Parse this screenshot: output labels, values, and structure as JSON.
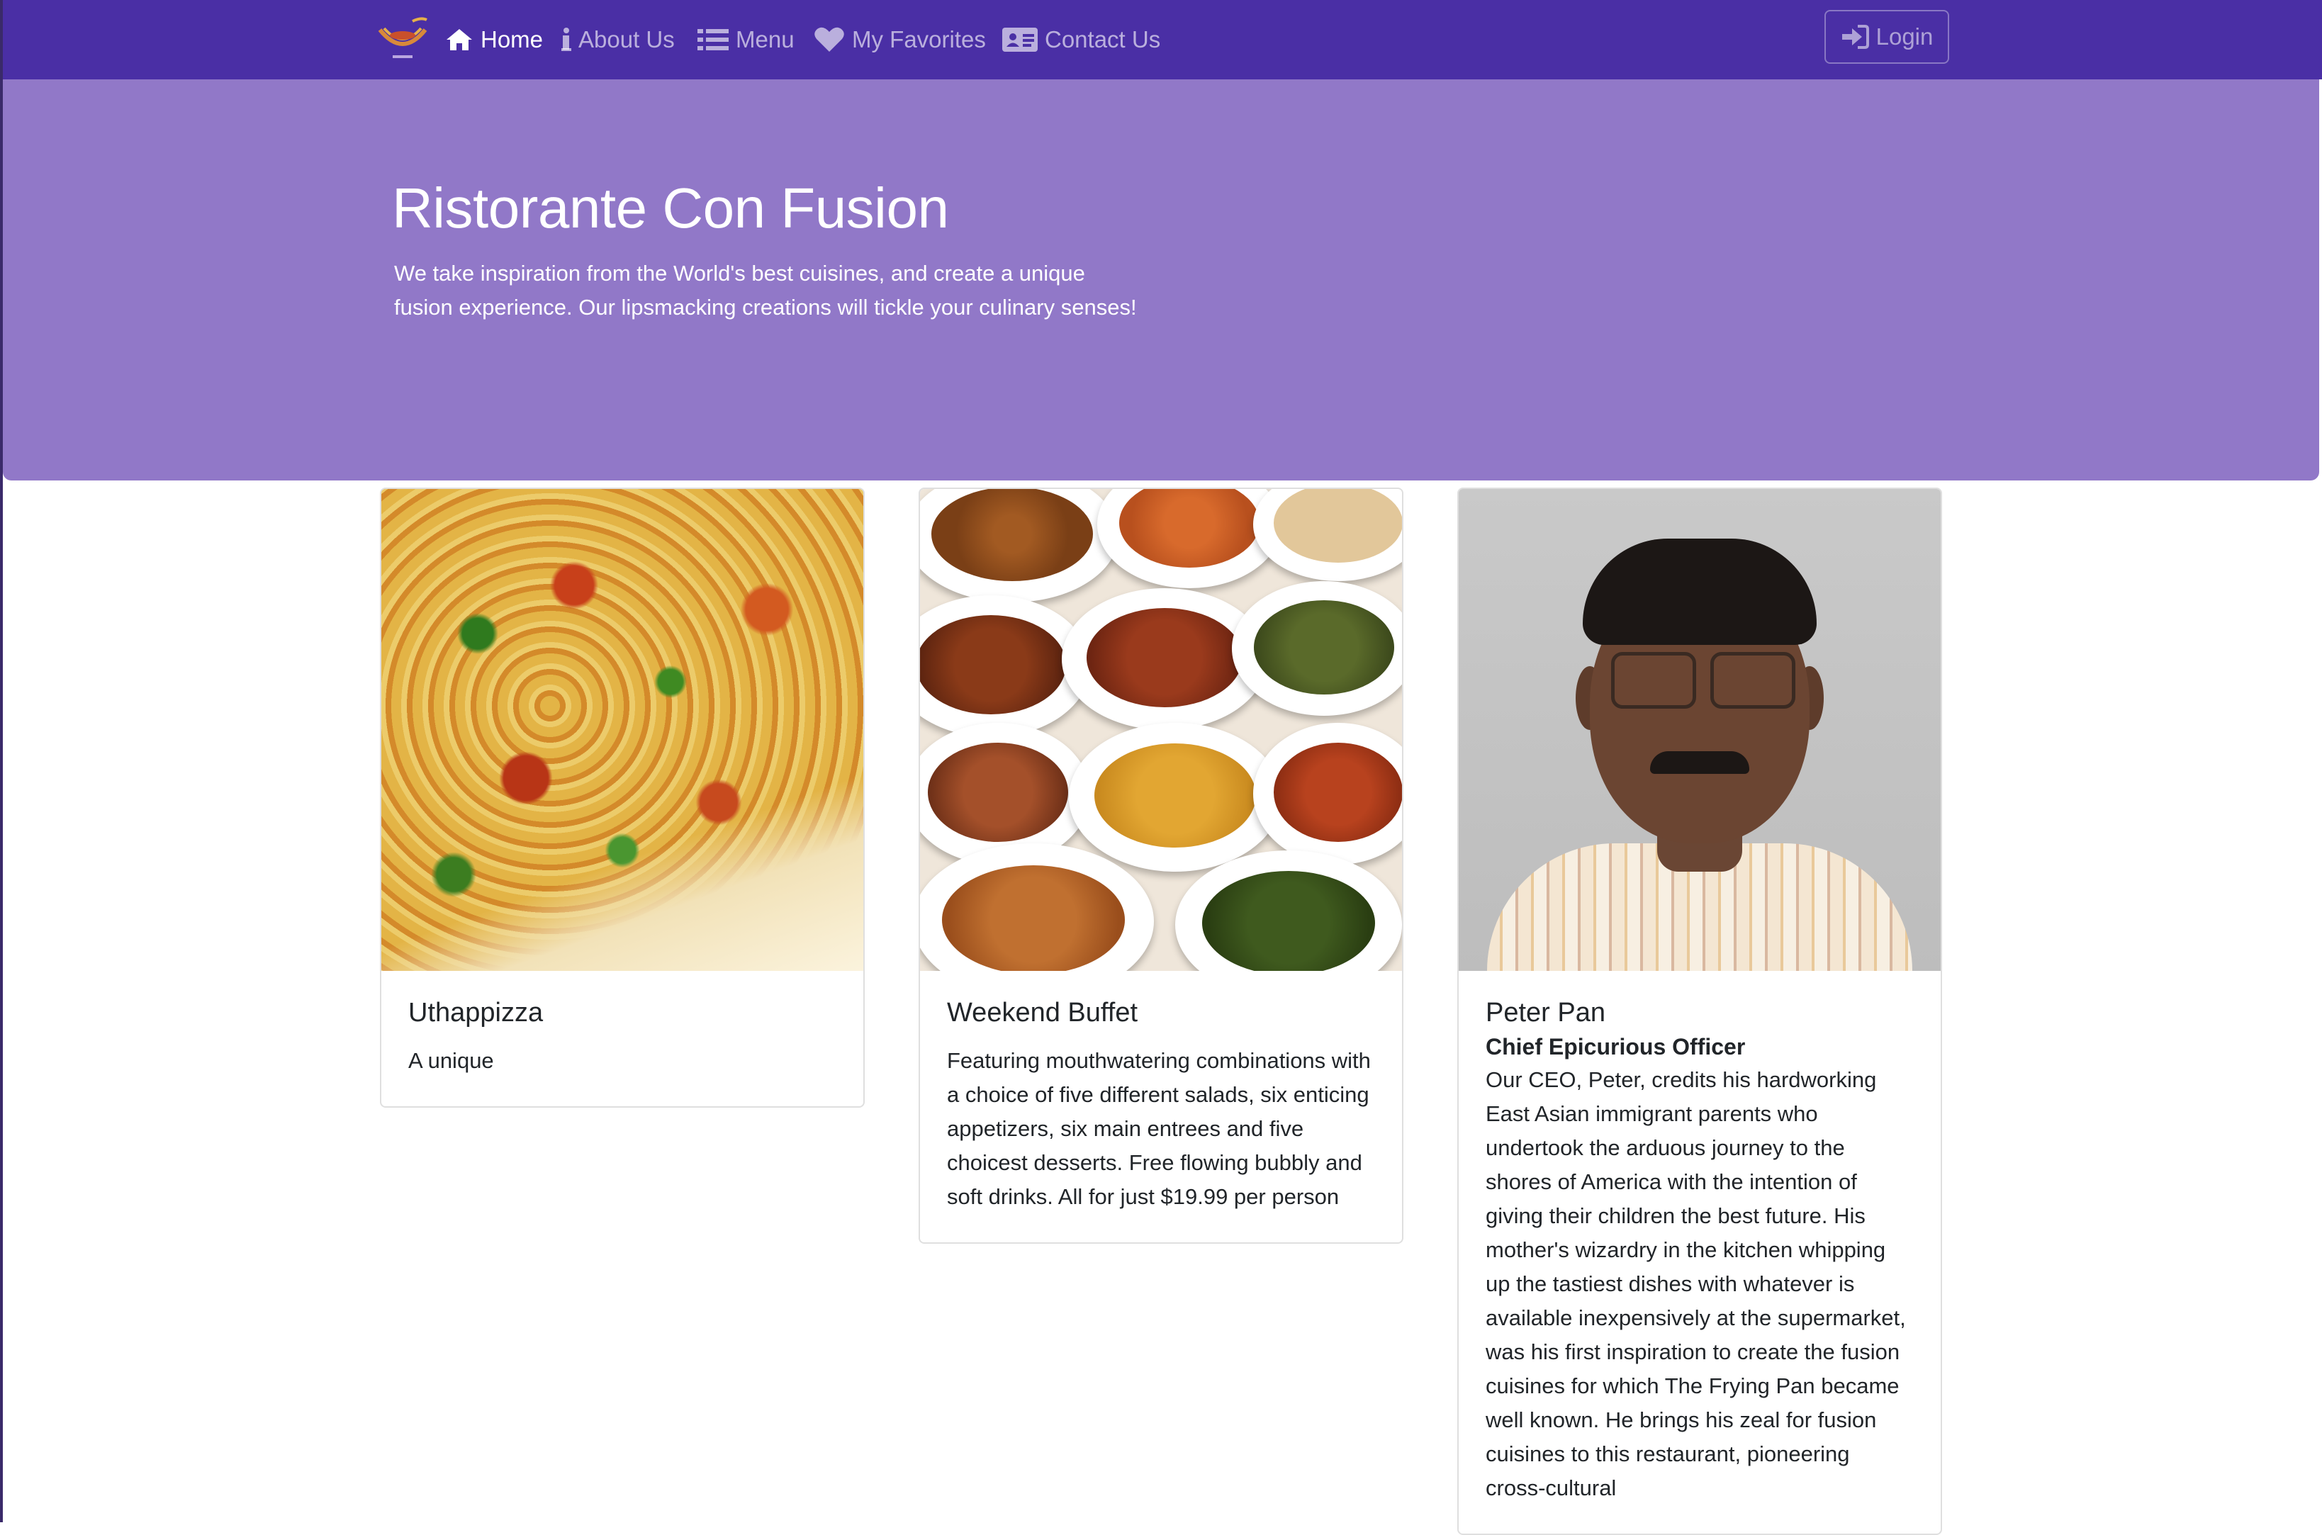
{
  "nav": {
    "items": [
      {
        "label": "Home",
        "icon": "home-icon",
        "active": true
      },
      {
        "label": "About Us",
        "icon": "info-icon",
        "active": false
      },
      {
        "label": "Menu",
        "icon": "list-icon",
        "active": false
      },
      {
        "label": "My Favorites",
        "icon": "heart-icon",
        "active": false
      },
      {
        "label": "Contact Us",
        "icon": "address-card-icon",
        "active": false
      }
    ],
    "login_label": "Login",
    "colors": {
      "navbar": "#4a2fa5",
      "jumbotron": "#9178c8"
    }
  },
  "hero": {
    "title": "Ristorante Con Fusion",
    "text": "We take inspiration from the World's best cuisines, and create a unique fusion experience. Our lipsmacking creations will tickle your culinary senses!"
  },
  "cards": [
    {
      "title": "Uthappizza",
      "text": "A unique"
    },
    {
      "title": "Weekend Buffet",
      "text": "Featuring mouthwatering combinations with a choice of five different salads, six enticing appetizers, six main entrees and five choicest desserts. Free flowing bubbly and soft drinks. All for just $19.99 per person"
    },
    {
      "title": "Peter Pan",
      "subtitle": "Chief Epicurious Officer",
      "text": "Our CEO, Peter, credits his hardworking East Asian immigrant parents who undertook the arduous journey to the shores of America with the intention of giving their children the best future. His mother's wizardry in the kitchen whipping up the tastiest dishes with whatever is available inexpensively at the supermarket, was his first inspiration to create the fusion cuisines for which The Frying Pan became well known. He brings his zeal for fusion cuisines to this restaurant, pioneering cross-cultural"
    }
  ]
}
